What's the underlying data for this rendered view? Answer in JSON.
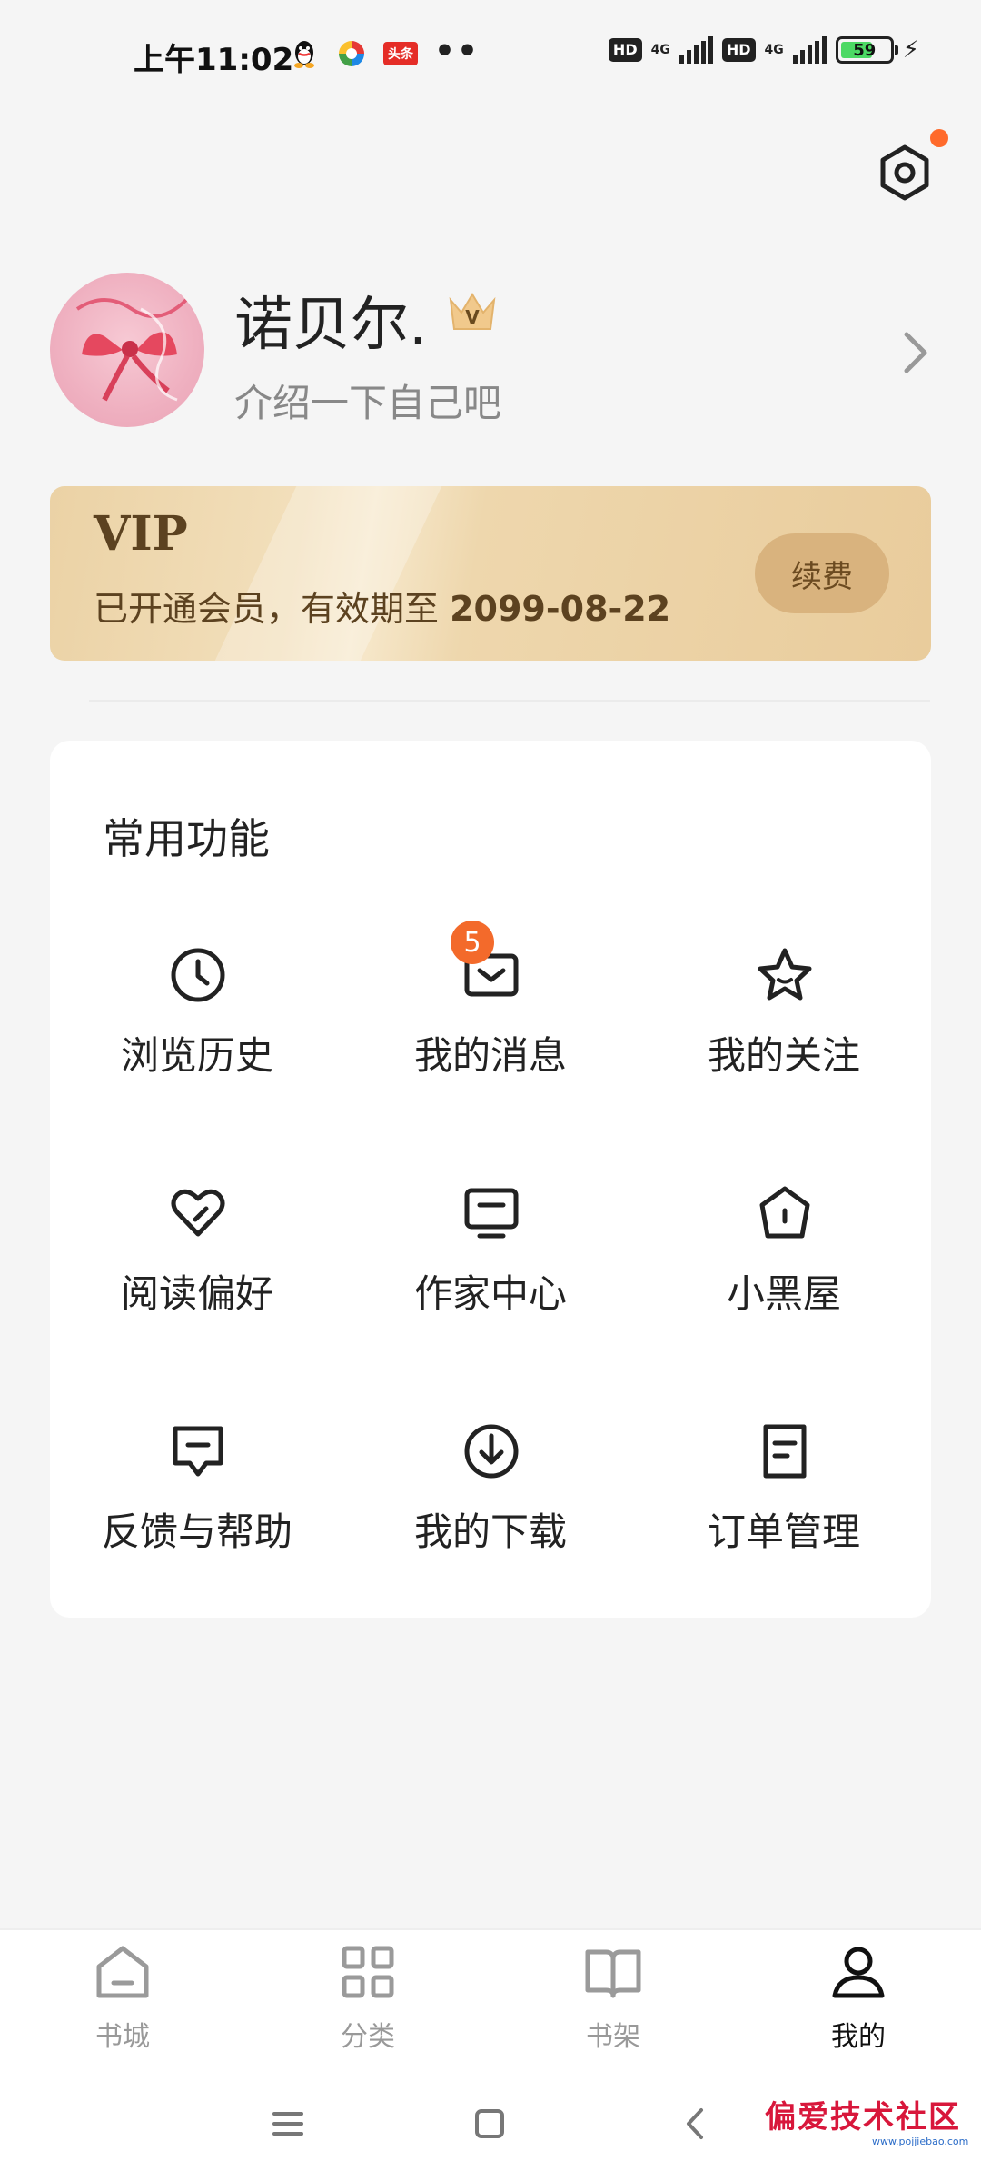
{
  "status_bar": {
    "time": "上午11:02",
    "app_icons": [
      "qq-icon",
      "browser-icon",
      "toutiao-icon"
    ],
    "toutiao_label": "头条",
    "more": "••",
    "hd1": "HD",
    "net1": "4G",
    "hd2": "HD",
    "net2": "4G",
    "battery": "59"
  },
  "header": {
    "settings_icon": "settings-icon",
    "has_notification_dot": true,
    "notification_dot_color": "#ff6a2b"
  },
  "profile": {
    "username": "诺贝尔.",
    "bio": "介绍一下自己吧",
    "crown_icon": "vip-crown-icon",
    "crown_letter": "V"
  },
  "vip": {
    "title": "VIP",
    "desc_prefix": "已开通会员，有效期至 ",
    "expiry": "2099-08-22",
    "renew_label": "续费",
    "accent": "#d9b37e"
  },
  "functions": {
    "title": "常用功能",
    "items": [
      {
        "label": "浏览历史",
        "icon": "clock-icon"
      },
      {
        "label": "我的消息",
        "icon": "message-icon",
        "badge": "5"
      },
      {
        "label": "我的关注",
        "icon": "star-icon"
      },
      {
        "label": "阅读偏好",
        "icon": "heart-icon"
      },
      {
        "label": "作家中心",
        "icon": "monitor-icon"
      },
      {
        "label": "小黑屋",
        "icon": "house-icon"
      },
      {
        "label": "反馈与帮助",
        "icon": "feedback-icon"
      },
      {
        "label": "我的下载",
        "icon": "download-icon"
      },
      {
        "label": "订单管理",
        "icon": "order-icon"
      }
    ]
  },
  "tabbar": {
    "tabs": [
      {
        "label": "书城",
        "icon": "home-icon",
        "active": false
      },
      {
        "label": "分类",
        "icon": "grid-icon",
        "active": false
      },
      {
        "label": "书架",
        "icon": "book-icon",
        "active": false
      },
      {
        "label": "我的",
        "icon": "user-icon",
        "active": true
      }
    ]
  },
  "watermark": {
    "text": "偏爱技术社区",
    "sub": "www.pojjiebao.com"
  }
}
